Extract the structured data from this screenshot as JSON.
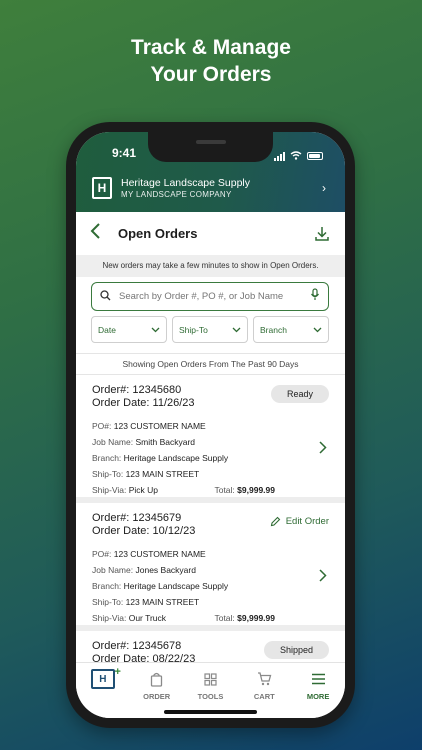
{
  "headline": {
    "line1": "Track & Manage",
    "line2": "Your Orders"
  },
  "statusbar": {
    "time": "9:41"
  },
  "company": {
    "logo_letter": "H",
    "name": "Heritage Landscape Supply",
    "subtitle": "MY LANDSCAPE COMPANY"
  },
  "page": {
    "title": "Open Orders"
  },
  "notice": "New orders may take a few minutes to show in Open Orders.",
  "search": {
    "placeholder": "Search by Order #, PO #, or Job Name"
  },
  "filters": {
    "date": "Date",
    "shipto": "Ship-To",
    "branch": "Branch"
  },
  "showing": "Showing Open Orders From The Past 90 Days",
  "labels": {
    "po": "PO#:",
    "job": "Job Name:",
    "branch": "Branch:",
    "shipto": "Ship-To:",
    "shipvia": "Ship-Via:",
    "total": "Total:",
    "edit_order": "Edit Order"
  },
  "orders": [
    {
      "number": "Order#: 12345680",
      "date": "Order Date: 11/26/23",
      "status": "Ready",
      "po": "123 CUSTOMER NAME",
      "job": "Smith Backyard",
      "branch": "Heritage Landscape Supply",
      "shipto": "123 MAIN STREET",
      "shipvia": "Pick Up",
      "total": "$9,999.99"
    },
    {
      "number": "Order#: 12345679",
      "date": "Order Date: 10/12/23",
      "po": "123 CUSTOMER NAME",
      "job": "Jones Backyard",
      "branch": "Heritage Landscape Supply",
      "shipto": "123 MAIN STREET",
      "shipvia": "Our Truck",
      "total": "$9,999.99"
    },
    {
      "number": "Order#: 12345678",
      "date": "Order Date: 08/22/23",
      "status": "Shipped"
    }
  ],
  "tabs": {
    "order": "ORDER",
    "tools": "TOOLS",
    "cart": "CART",
    "more": "MORE"
  },
  "colors": {
    "accent": "#2f6b34",
    "brand_blue": "#1f4f74"
  }
}
